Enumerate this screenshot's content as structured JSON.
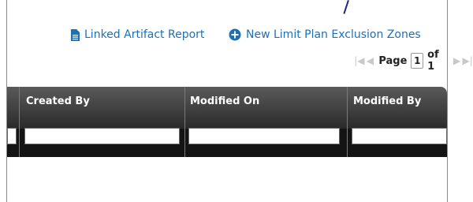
{
  "toolbar": {
    "linked_report_label": "Linked Artifact Report",
    "new_plan_label": "New Limit Plan Exclusion Zones"
  },
  "pager": {
    "page_label": "Page",
    "current_page": "1",
    "of_label": "of 1"
  },
  "grid": {
    "columns": [
      {
        "title": "Created By"
      },
      {
        "title": "Modified On"
      },
      {
        "title": "Modified By"
      }
    ],
    "filter_values": [
      "",
      "",
      "",
      ""
    ]
  },
  "colors": {
    "link": "#1f6fb5",
    "header_dark": "#2a2a2a",
    "pointer": "#1c2a7a"
  }
}
